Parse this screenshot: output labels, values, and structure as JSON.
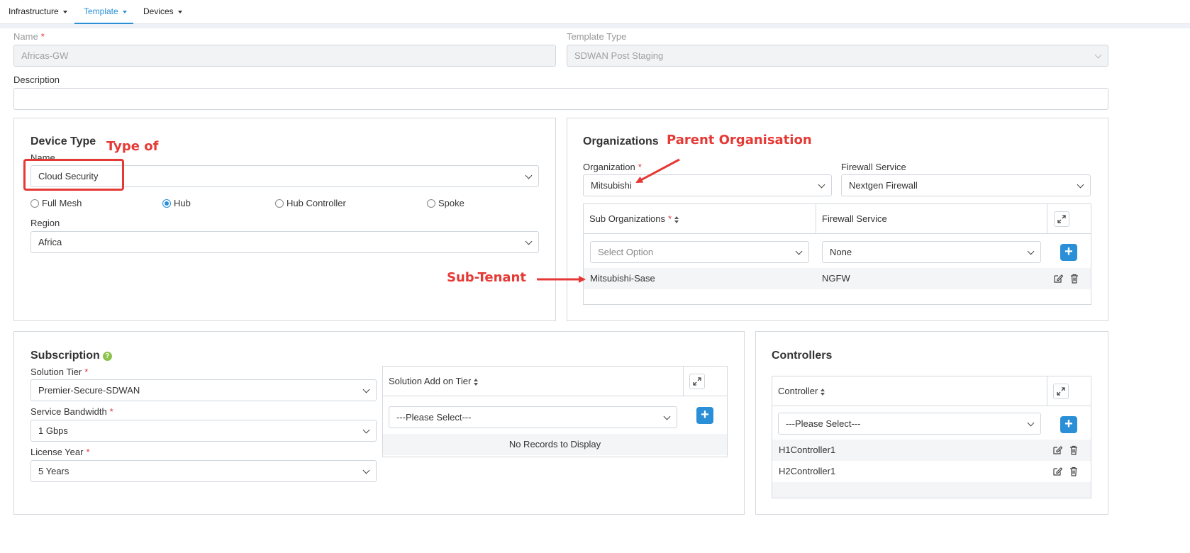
{
  "nav": {
    "tabs": [
      {
        "label": "Infrastructure"
      },
      {
        "label": "Template"
      },
      {
        "label": "Devices"
      }
    ]
  },
  "form": {
    "name_label": "Name",
    "name_value": "Africas-GW",
    "template_type_label": "Template Type",
    "template_type_value": "SDWAN Post Staging",
    "description_label": "Description",
    "description_value": ""
  },
  "device_type": {
    "title": "Device Type",
    "name_label": "Name",
    "name_value": "Cloud Security",
    "topology_options": [
      {
        "label": "Full Mesh",
        "selected": false
      },
      {
        "label": "Hub",
        "selected": true
      },
      {
        "label": "Hub Controller",
        "selected": false
      },
      {
        "label": "Spoke",
        "selected": false
      }
    ],
    "region_label": "Region",
    "region_value": "Africa"
  },
  "organizations": {
    "title": "Organizations",
    "org_label": "Organization",
    "org_value": "Mitsubishi",
    "firewall_label": "Firewall Service",
    "firewall_value": "Nextgen Firewall",
    "grid": {
      "col_sub_orgs": "Sub Organizations",
      "col_firewall": "Firewall Service",
      "select_placeholder": "Select Option",
      "firewall_select_value": "None",
      "rows": [
        {
          "sub_org": "Mitsubishi-Sase",
          "firewall": "NGFW"
        }
      ]
    }
  },
  "subscription": {
    "title": "Subscription",
    "help": "?",
    "solution_tier_label": "Solution Tier",
    "solution_tier_value": "Premier-Secure-SDWAN",
    "bandwidth_label": "Service Bandwidth",
    "bandwidth_value": "1 Gbps",
    "license_label": "License Year",
    "license_value": "5 Years",
    "addon_grid": {
      "col_addon": "Solution Add on Tier",
      "select_placeholder": "---Please Select---",
      "empty_text": "No Records to Display"
    }
  },
  "controllers": {
    "title": "Controllers",
    "grid": {
      "col_controller": "Controller",
      "select_placeholder": "---Please Select---",
      "rows": [
        {
          "name": "H1Controller1"
        },
        {
          "name": "H2Controller1"
        }
      ]
    }
  },
  "annotations": {
    "type_of": "Type of",
    "parent_org": "Parent Organisation",
    "sub_tenant": "Sub-Tenant"
  },
  "colors": {
    "accent": "#2a8fd6",
    "annotation": "#e53935",
    "required": "#e0383e",
    "help": "#8bc34a"
  }
}
